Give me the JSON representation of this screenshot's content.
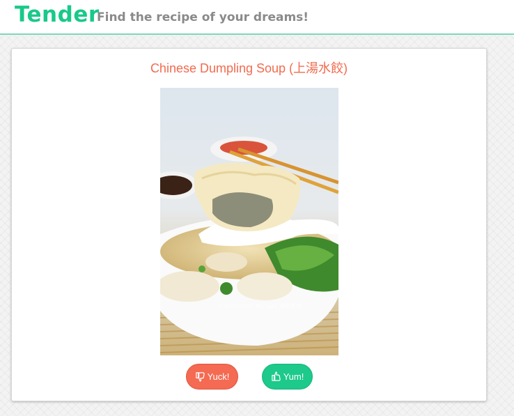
{
  "header": {
    "brand": "Tender",
    "tagline": "Find the recipe of your dreams!"
  },
  "recipe": {
    "title": "Chinese Dumpling Soup (上湯水餃)",
    "photo_watermark": "© Christine's Recipes 簡易食譜"
  },
  "actions": {
    "yuck_label": "Yuck!",
    "yuck_icon": "thumbs-down-icon",
    "yum_label": "Yum!",
    "yum_icon": "thumbs-up-icon"
  },
  "colors": {
    "brand": "#19c98a",
    "title": "#f26b4e",
    "yuck": "#f46a52",
    "yum": "#1dc98b"
  }
}
